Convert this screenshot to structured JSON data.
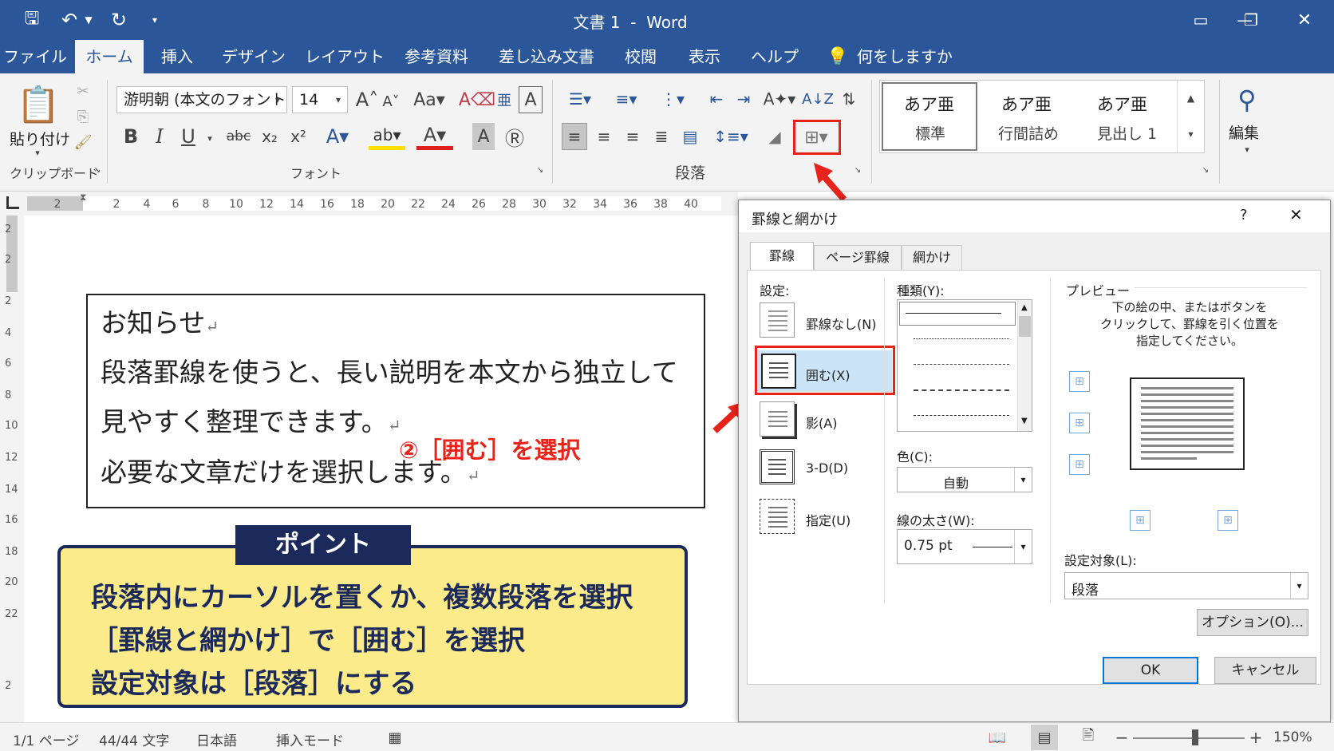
{
  "titlebar": {
    "title": "文書 1  -  Word"
  },
  "tabs": [
    {
      "label": "ファイル"
    },
    {
      "label": "ホーム"
    },
    {
      "label": "挿入"
    },
    {
      "label": "デザイン"
    },
    {
      "label": "レイアウト"
    },
    {
      "label": "参考資料"
    },
    {
      "label": "差し込み文書"
    },
    {
      "label": "校閲"
    },
    {
      "label": "表示"
    },
    {
      "label": "ヘルプ"
    }
  ],
  "tellme": "何をしますか",
  "ribbon": {
    "paste_label": "貼り付け",
    "clipboard_label": "クリップボード",
    "font_name": "游明朝 (本文のフォント",
    "font_size": "14",
    "font_label": "フォント",
    "paragraph_label": "段落",
    "styles": [
      {
        "sample": "あア亜",
        "name": "標準"
      },
      {
        "sample": "あア亜",
        "name": "行間詰め"
      },
      {
        "sample": "あア亜",
        "name": "見出し 1"
      }
    ],
    "edit_label": "編集"
  },
  "ruler": {
    "numbers": [
      "2",
      "2",
      "4",
      "6",
      "8",
      "10",
      "12",
      "14",
      "16",
      "18",
      "20",
      "22",
      "24",
      "26",
      "28",
      "30",
      "32",
      "34",
      "36",
      "38",
      "40"
    ]
  },
  "vruler": {
    "numbers": [
      "2",
      "2",
      "2",
      "4",
      "6",
      "8",
      "10",
      "12",
      "14",
      "16",
      "18",
      "20",
      "22",
      "2"
    ]
  },
  "document": {
    "lines": [
      "お知らせ",
      "段落罫線を使うと、長い説明を本文から独立して",
      "見やすく整理できます。",
      "必要な文章だけを選択します。"
    ],
    "para_mark": "↵"
  },
  "callout": "②［囲む］を選択",
  "point": {
    "tag": "ポイント",
    "lines": [
      "段落内にカーソルを置くか、複数段落を選択",
      "［罫線と網かけ］で［囲む］を選択",
      "設定対象は［段落］にする"
    ]
  },
  "dialog": {
    "title": "罫線と網かけ",
    "help": "?",
    "close": "✕",
    "tabs": [
      "罫線",
      "ページ罫線",
      "網かけ"
    ],
    "settings_label": "設定:",
    "settings": [
      "罫線なし(N)",
      "囲む(X)",
      "影(A)",
      "3-D(D)",
      "指定(U)"
    ],
    "style_label": "種類(Y):",
    "color_label": "色(C):",
    "color_value": "自動",
    "width_label": "線の太さ(W):",
    "width_value": "0.75 pt",
    "preview_label": "プレビュー",
    "preview_desc": [
      "下の絵の中、またはボタンを",
      "クリックして、罫線を引く位置を",
      "指定してください。"
    ],
    "apply_label": "設定対象(L):",
    "apply_value": "段落",
    "options_button": "オプション(O)...",
    "ok_button": "OK",
    "cancel_button": "キャンセル"
  },
  "status": {
    "page": "1/1 ページ",
    "words": "44/44 文字",
    "lang": "日本語",
    "mode": "挿入モード",
    "zoom": "150%"
  },
  "colors": {
    "title_bg": "#2b579a",
    "accent_red": "#e8231a",
    "point_bg": "#fbeb8a",
    "point_navy": "#1c2a5b"
  }
}
